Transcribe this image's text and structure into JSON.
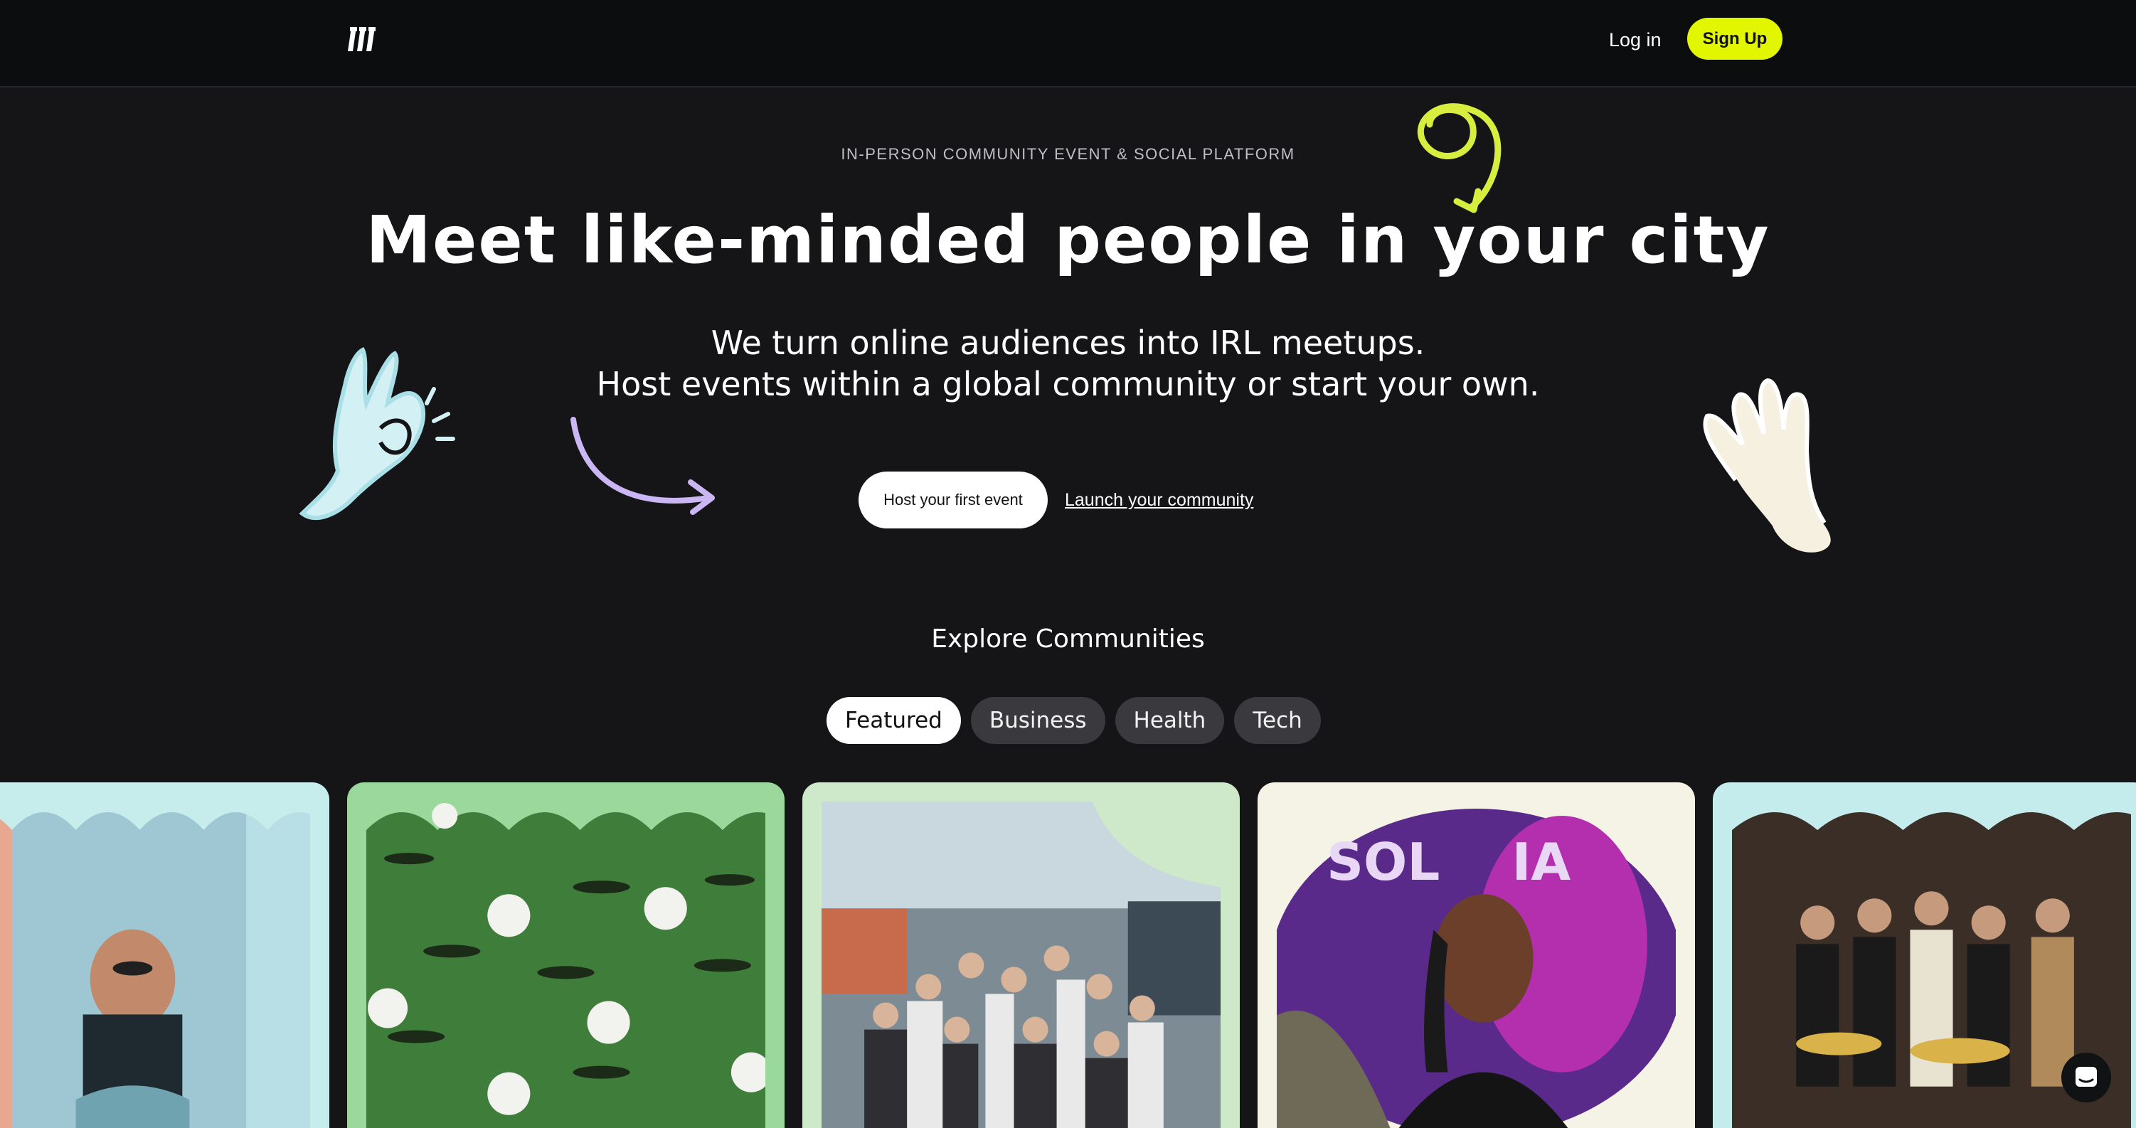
{
  "header": {
    "logo_icon": "brand-logo-slashes-icon",
    "login_label": "Log in",
    "signup_label": "Sign Up",
    "signup_color": "#e2f600"
  },
  "hero": {
    "eyebrow": "IN-PERSON COMMUNITY EVENT & SOCIAL PLATFORM",
    "headline": "Meet like-minded people in your city",
    "sub_line1": "We turn online audiences into IRL meetups.",
    "sub_line2": "Host events within a global community or start your own.",
    "cta_primary": "Host your first event",
    "cta_secondary": "Launch your community"
  },
  "explore": {
    "title": "Explore Communities",
    "tabs": [
      {
        "label": "Featured",
        "active": true
      },
      {
        "label": "Business",
        "active": false
      },
      {
        "label": "Health",
        "active": false
      },
      {
        "label": "Tech",
        "active": false
      }
    ],
    "cards": [
      {
        "image": "meditation-man-photo",
        "bg": "#c6ecec"
      },
      {
        "image": "golf-balls-on-green-photo",
        "bg": "#9ad89b"
      },
      {
        "image": "group-bar-meetup-photo",
        "bg": "#cde9c9"
      },
      {
        "image": "woman-solana-event-photo",
        "bg": "#f5f3e6"
      },
      {
        "image": "men-evening-gathering-photo",
        "bg": "#c4ecec"
      }
    ]
  },
  "colors": {
    "background": "#151518",
    "header_bg": "#0c0d0f",
    "accent_lime": "#e2f600",
    "accent_lavender": "#c9b6f2",
    "accent_aqua": "#c6ecf0"
  },
  "chat_icon": "chat-bubble-icon"
}
